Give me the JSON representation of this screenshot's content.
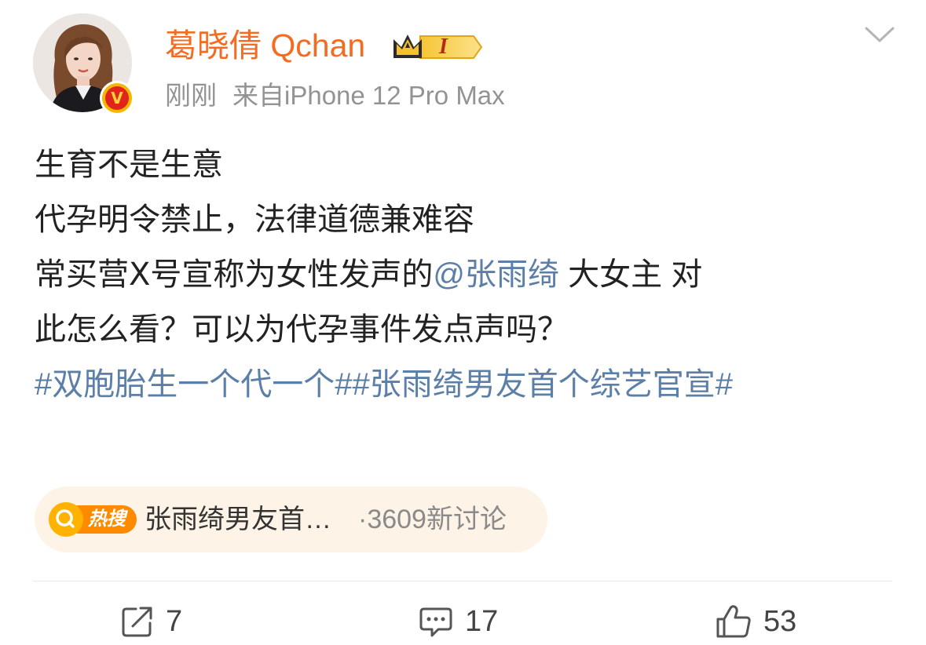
{
  "post": {
    "author": {
      "name": "葛晓倩 Qchan",
      "vip_level": "I",
      "verified_mark": "V"
    },
    "time": "刚刚",
    "source": "来自iPhone 12 Pro Max",
    "text": {
      "line1": "生育不是生意",
      "line2": "代孕明令禁止，法律道德兼难容",
      "line3_before": "常买营Ⅹ号宣称为女性发声的",
      "mention": "@张雨绮",
      "line3_after": " 大女主 对",
      "line4": "此怎么看？可以为代孕事件发点声吗？",
      "hashtags": "#双胞胎生一个代一个##张雨绮男友首个综艺官宣#"
    },
    "hot_search": {
      "badge_label": "热搜",
      "title": "张雨绮男友首…",
      "count": "·3609新讨论"
    },
    "actions": {
      "repost_count": "7",
      "comment_count": "17",
      "like_count": "53"
    }
  },
  "icons": {
    "more": "chevron-down-icon",
    "repost": "share-icon",
    "comment": "comment-icon",
    "like": "thumbs-up-icon",
    "search": "search-icon",
    "crown": "crown-icon"
  },
  "colors": {
    "username": "#f36c21",
    "link": "#5c7fa8",
    "hot_pill_bg": "#fdf4e7",
    "hot_badge": "#ff8a00",
    "verify_badge_outer": "#f5b700",
    "verify_badge_inner": "#e0261c"
  }
}
